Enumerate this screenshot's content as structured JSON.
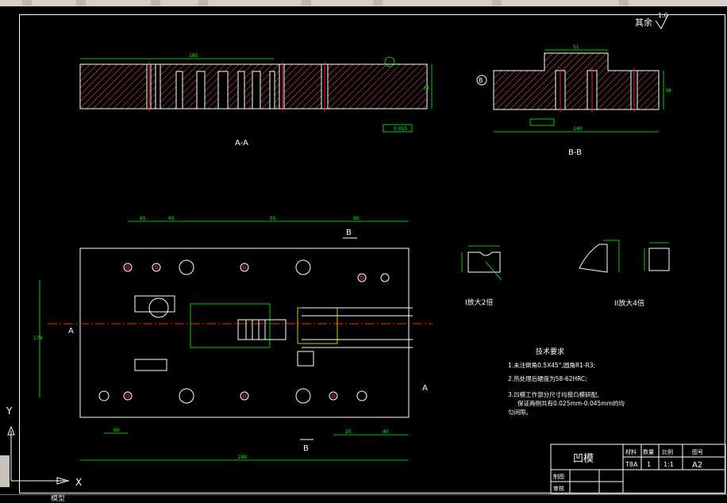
{
  "surface_roughness": {
    "label": "其余",
    "value": "1.6"
  },
  "views": {
    "section_aa": {
      "title": "A-A",
      "dim_length": "185",
      "dim_height": "38",
      "tolerance_note": "0.015"
    },
    "section_bb": {
      "title": "B-B",
      "dim_width": "140",
      "dim_top": "51",
      "dim_height": "38",
      "mark": "B"
    },
    "plan": {
      "dim_total": "280",
      "dims_top": [
        "65",
        "65",
        "55",
        "90"
      ],
      "dims_bottom": [
        "60",
        "25",
        "40"
      ],
      "dim_left": "178",
      "marks": [
        "A",
        "A",
        "B",
        "B"
      ]
    },
    "detail_1": {
      "title": "I放大2倍"
    },
    "detail_2": {
      "title": "II放大4倍"
    }
  },
  "tech_requirements": {
    "heading": "技术要求",
    "items": [
      "1.未注倒角0.5X45°,圆角R1-R3;",
      "2.热处理后硬度为58-62HRC;",
      "3.凹模工作部分尺寸均按凸模研配,",
      "保证两侧共有0.025mm-0.045mm的均",
      "匀间隙。"
    ]
  },
  "title_block": {
    "part_name": "凹模",
    "headers": [
      "材料",
      "数量",
      "比例",
      "图号"
    ],
    "values": [
      "T8A",
      "1",
      "1:1",
      "A2"
    ],
    "rows": [
      "制图",
      "审核"
    ]
  },
  "ucs": {
    "x": "X",
    "y": "Y"
  },
  "command_line": "模型"
}
